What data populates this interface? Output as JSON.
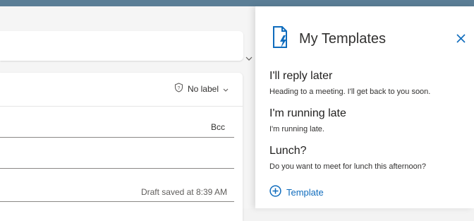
{
  "compose": {
    "sensitivity_label": "No label",
    "bcc_label": "Bcc",
    "draft_status": "Draft saved at 8:39 AM"
  },
  "templates_panel": {
    "title": "My Templates",
    "items": [
      {
        "title": "I'll reply later",
        "body": "Heading to a meeting. I'll get back to you soon."
      },
      {
        "title": "I'm running late",
        "body": "I'm running late."
      },
      {
        "title": "Lunch?",
        "body": "Do you want to meet for lunch this afternoon?"
      }
    ],
    "add_label": "Template"
  },
  "colors": {
    "accent": "#0f6cbd",
    "topbar": "#5b7e96"
  },
  "icons": [
    "chevron-down-icon",
    "shield-label-icon",
    "template-doc-icon",
    "close-icon",
    "add-circle-icon"
  ]
}
